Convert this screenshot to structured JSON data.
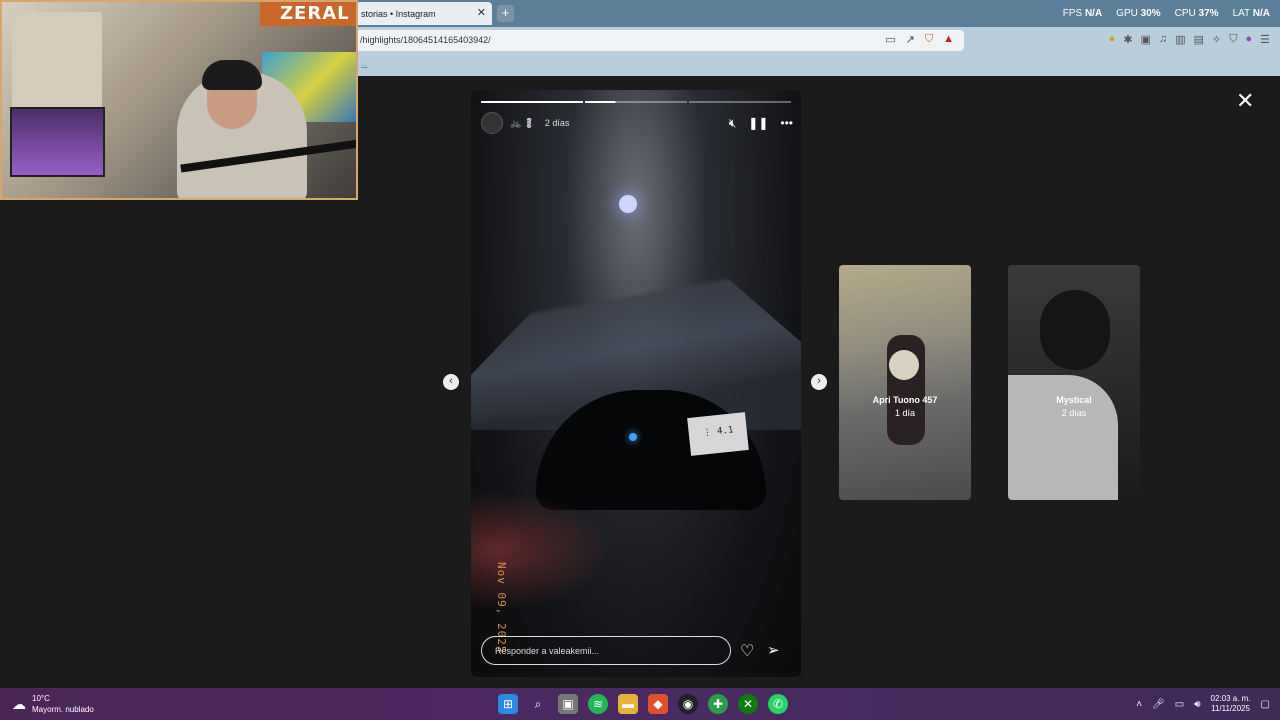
{
  "browser": {
    "tab_title": "storias • Instagram",
    "tab_close": "✕",
    "new_tab": "+",
    "url": "/highlights/18064514165403942/",
    "bookmark": "..."
  },
  "stats": {
    "fps_label": "FPS",
    "fps_value": "N/A",
    "gpu_label": "GPU",
    "gpu_value": "30%",
    "cpu_label": "CPU",
    "cpu_value": "37%",
    "lat_label": "LAT",
    "lat_value": "N/A"
  },
  "overlay": {
    "webcam_brand": "ZERAL"
  },
  "story": {
    "emojis": "🚲 💈",
    "time": "2 días",
    "date_stamp": "Nov 09, 2025",
    "reply_placeholder": "Responder a valeakemii...",
    "progress_segments": [
      1,
      0.3,
      0
    ]
  },
  "previews": [
    {
      "title": "Apri Tuono 457",
      "time": "1 día"
    },
    {
      "title": "Mystical",
      "time": "2 días"
    }
  ],
  "taskbar": {
    "temperature": "10°C",
    "weather": "Mayorm. nublado",
    "time": "02:03 a. m.",
    "date": "11/11/2025"
  },
  "icons": {
    "close_viewer": "close-icon",
    "prev": "chevron-left-icon",
    "next": "chevron-right-icon",
    "mute": "muted-speaker-icon",
    "pause": "pause-icon",
    "more": "more-icon",
    "like": "heart-icon",
    "send": "send-icon"
  }
}
